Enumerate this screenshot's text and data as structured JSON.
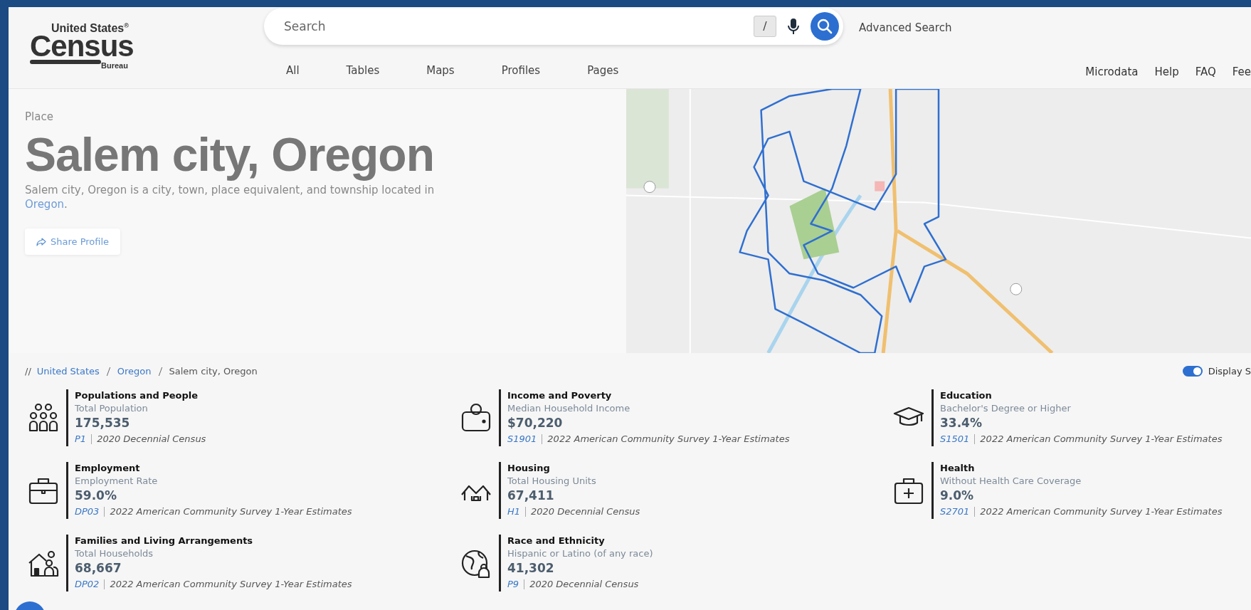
{
  "logo": {
    "top": "United States",
    "mark": "®",
    "main": "Census",
    "bottom": "Bureau"
  },
  "search": {
    "placeholder": "Search",
    "shortcut": "/"
  },
  "advanced_search": "Advanced Search",
  "tabs": [
    {
      "label": "All",
      "selected": false
    },
    {
      "label": "Tables",
      "selected": false
    },
    {
      "label": "Maps",
      "selected": false
    },
    {
      "label": "Profiles",
      "selected": false
    },
    {
      "label": "Pages",
      "selected": false
    }
  ],
  "utility_links": [
    "Microdata",
    "Help",
    "FAQ",
    "Fee"
  ],
  "hero": {
    "type_label": "Place",
    "title": "Salem city, Oregon",
    "description": "Salem city, Oregon is a city, town, place equivalent, and township located in",
    "description_link": "Oregon",
    "description_end": ".",
    "share_button": "Share Profile"
  },
  "breadcrumb": {
    "separator_start": "//",
    "items": [
      {
        "label": "United States",
        "link": true
      },
      {
        "label": "Oregon",
        "link": true
      },
      {
        "label": "Salem city, Oregon",
        "link": false
      }
    ]
  },
  "display_toggle": {
    "label": "Display S",
    "on": true
  },
  "stats": [
    {
      "kind": "people",
      "topic": "Populations and People",
      "measure": "Total Population",
      "value": "175,535",
      "table": "P1",
      "source": "2020 Decennial Census"
    },
    {
      "kind": "wallet",
      "topic": "Income and Poverty",
      "measure": "Median Household Income",
      "value": "$70,220",
      "table": "S1901",
      "source": "2022 American Community Survey 1-Year Estimates"
    },
    {
      "kind": "cap",
      "topic": "Education",
      "measure": "Bachelor's Degree or Higher",
      "value": "33.4%",
      "table": "S1501",
      "source": "2022 American Community Survey 1-Year Estimates"
    },
    {
      "kind": "briefcase",
      "topic": "Employment",
      "measure": "Employment Rate",
      "value": "59.0%",
      "table": "DP03",
      "source": "2022 American Community Survey 1-Year Estimates"
    },
    {
      "kind": "houses",
      "topic": "Housing",
      "measure": "Total Housing Units",
      "value": "67,411",
      "table": "H1",
      "source": "2020 Decennial Census"
    },
    {
      "kind": "medkit",
      "topic": "Health",
      "measure": "Without Health Care Coverage",
      "value": "9.0%",
      "table": "S2701",
      "source": "2022 American Community Survey 1-Year Estimates"
    },
    {
      "kind": "family",
      "topic": "Families and Living Arrangements",
      "measure": "Total Households",
      "value": "68,667",
      "table": "DP02",
      "source": "2022 American Community Survey 1-Year Estimates"
    },
    {
      "kind": "globe",
      "topic": "Race and Ethnicity",
      "measure": "Hispanic or Latino (of any race)",
      "value": "41,302",
      "table": "P9",
      "source": "2020 Decennial Census"
    }
  ]
}
